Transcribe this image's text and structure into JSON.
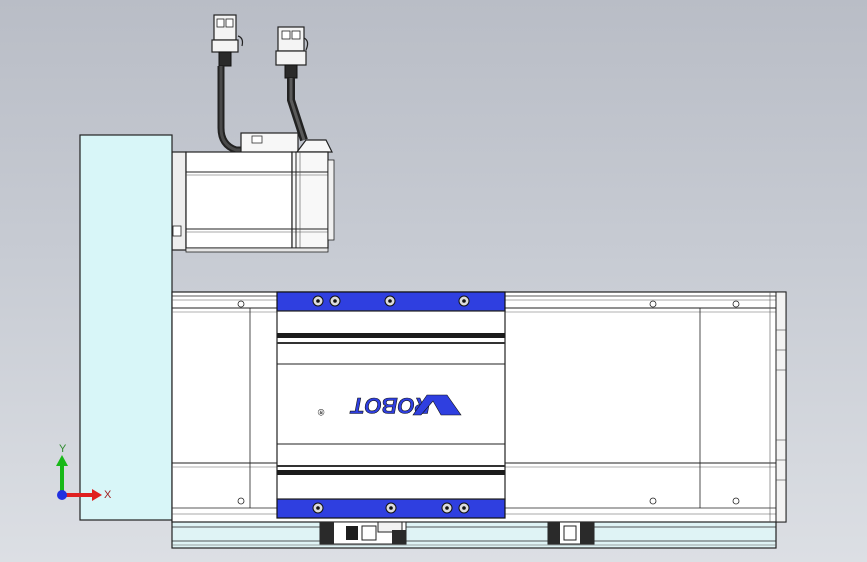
{
  "viewport": {
    "background_top": "#b9bdc6",
    "background_bottom": "#dcdfe4"
  },
  "model": {
    "logo_text": "ROBOT",
    "logo_mark": "®",
    "carriage_color": "#2f3fe0",
    "side_plate_color": "#d8f6f8",
    "base_rail_color": "#dff3f5"
  },
  "triad": {
    "x_label": "X",
    "y_label": "Y",
    "x_color": "#e02020",
    "y_color": "#18b818",
    "z_color": "#2030e0"
  }
}
